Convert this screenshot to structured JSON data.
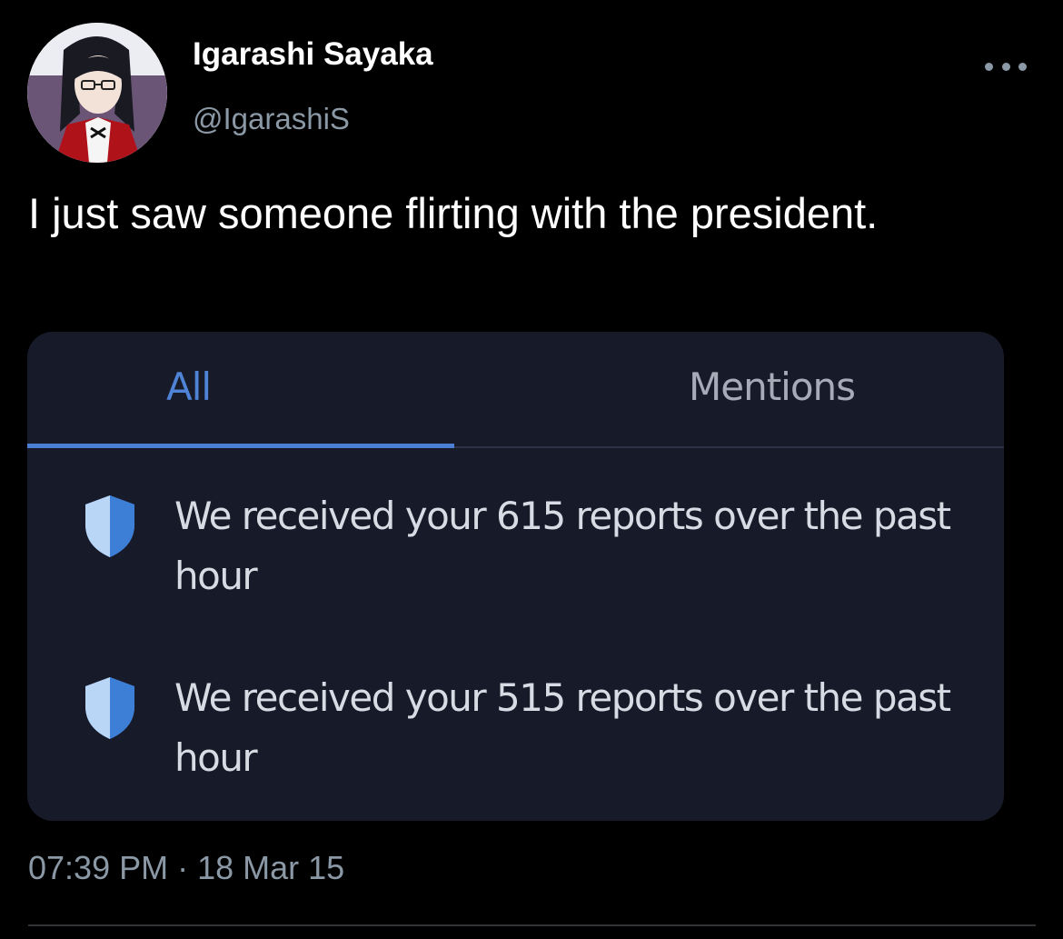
{
  "tweet": {
    "display_name": "Igarashi Sayaka",
    "handle": "@IgarashiS",
    "text": "I just saw someone flirting with the president.",
    "timestamp": "07:39 PM · 18 Mar 15",
    "more_icon": "more-horizontal-icon"
  },
  "media": {
    "tabs": [
      {
        "label": "All",
        "active": true
      },
      {
        "label": "Mentions",
        "active": false
      }
    ],
    "notifications": [
      {
        "icon": "shield-icon",
        "text": "We received your 615 reports over the past hour"
      },
      {
        "icon": "shield-icon",
        "text": "We received your 515 reports over the past hour"
      }
    ]
  },
  "colors": {
    "background": "#000000",
    "secondary_text": "#8b98a5",
    "card_background": "#171b29",
    "active_tab": "#4f83d6",
    "shield_blue": "#4a90e2"
  }
}
